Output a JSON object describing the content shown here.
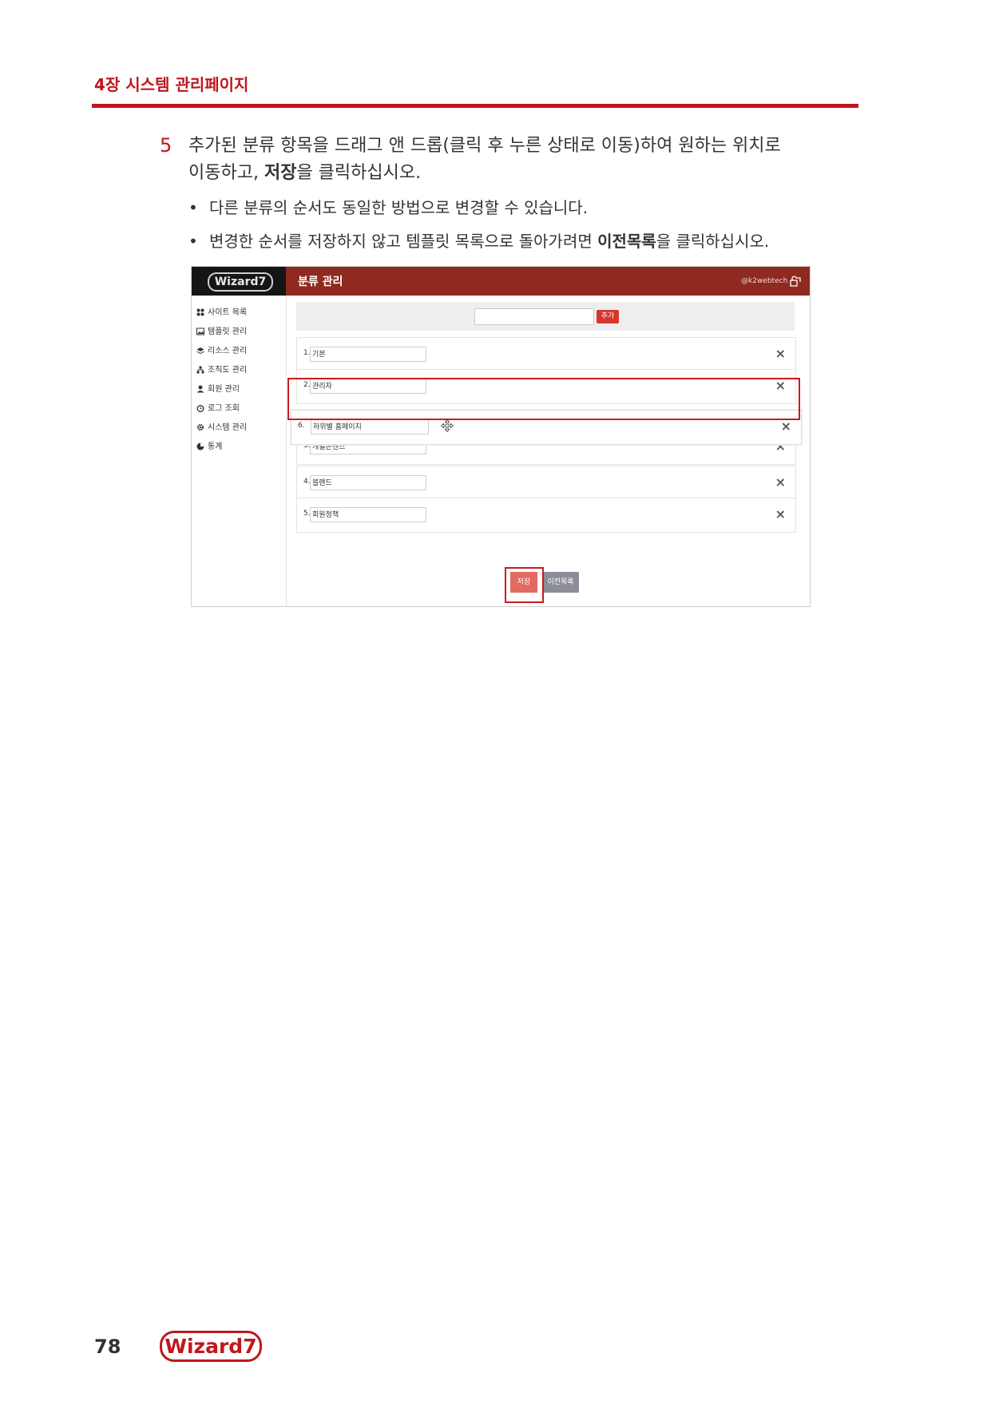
{
  "chapter": {
    "title": "4장 시스템 관리페이지"
  },
  "step": {
    "number": "5",
    "line1": "추가된 분류 항목을 드래그 앤 드롭(클릭 후 누른 상태로 이동)하여 원하는 위치로",
    "line2_before": "이동하고, ",
    "line2_bold": "저장",
    "line2_after": "을 클릭하십시오."
  },
  "bullets": [
    {
      "text": "다른 분류의 순서도 동일한 방법으로 변경할 수 있습니다."
    },
    {
      "text_before": "변경한 순서를 저장하지 않고 템플릿 목록으로 돌아가려면 ",
      "text_bold": "이전목록",
      "text_after": "을 클릭하십시오."
    }
  ],
  "screenshot": {
    "logo": "Wizard7",
    "title": "분류 관리",
    "user": "@k2webtech",
    "sidebar": [
      {
        "label": "사이트 목록",
        "icon": "grid-icon"
      },
      {
        "label": "템플릿 관리",
        "icon": "image-icon"
      },
      {
        "label": "리소스 관리",
        "icon": "layers-icon"
      },
      {
        "label": "조직도 관리",
        "icon": "sitemap-icon"
      },
      {
        "label": "회원 관리",
        "icon": "user-icon"
      },
      {
        "label": "로그 조회",
        "icon": "alarm-icon"
      },
      {
        "label": "시스템 관리",
        "icon": "gear-icon"
      },
      {
        "label": "통계",
        "icon": "pie-icon"
      }
    ],
    "add_button": "추가",
    "rows": [
      {
        "num": "1.",
        "value": "기본"
      },
      {
        "num": "2.",
        "value": "관리자"
      },
      {
        "num": "3.",
        "value": "개별콘텐츠"
      },
      {
        "num": "4.",
        "value": "블랜드"
      },
      {
        "num": "5.",
        "value": "회원정책"
      }
    ],
    "dragged": {
      "num": "6.",
      "value": "하위별 홈페이지"
    },
    "delete_symbol": "×",
    "save_button": "저장",
    "prev_button": "이전목록"
  },
  "footer": {
    "page_number": "78",
    "logo": "Wizard7"
  }
}
